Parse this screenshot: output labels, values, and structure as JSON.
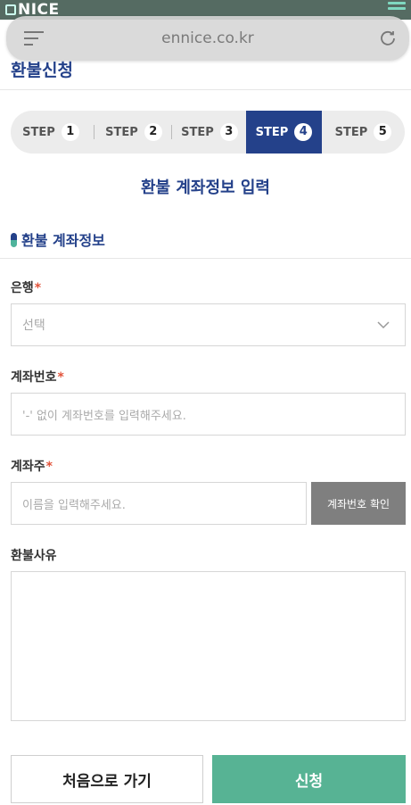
{
  "header": {
    "logo_text": "NICE"
  },
  "browser": {
    "url": "ennice.co.kr"
  },
  "page": {
    "title": "환불신청"
  },
  "steps": [
    {
      "label": "STEP",
      "num": "1",
      "active": false
    },
    {
      "label": "STEP",
      "num": "2",
      "active": false
    },
    {
      "label": "STEP",
      "num": "3",
      "active": false
    },
    {
      "label": "STEP",
      "num": "4",
      "active": true
    },
    {
      "label": "STEP",
      "num": "5",
      "active": false
    }
  ],
  "section": {
    "heading": "환불 계좌정보 입력",
    "subheading": "환불 계좌정보"
  },
  "form": {
    "bank": {
      "label": "은행",
      "required_mark": "*",
      "value": "선택"
    },
    "account_number": {
      "label": "계좌번호",
      "required_mark": "*",
      "placeholder": "'-' 없이 계좌번호를 입력해주세요."
    },
    "account_holder": {
      "label": "계좌주",
      "required_mark": "*",
      "placeholder": "이름을 입력해주세요.",
      "verify_label": "계좌번호 확인"
    },
    "reason": {
      "label": "환불사유",
      "value": ""
    }
  },
  "actions": {
    "home_label": "처음으로 가기",
    "submit_label": "신청"
  },
  "colors": {
    "primary": "#24418a",
    "accent": "#57b394",
    "required": "#e2533a",
    "verify_button": "#7f7f7f"
  }
}
